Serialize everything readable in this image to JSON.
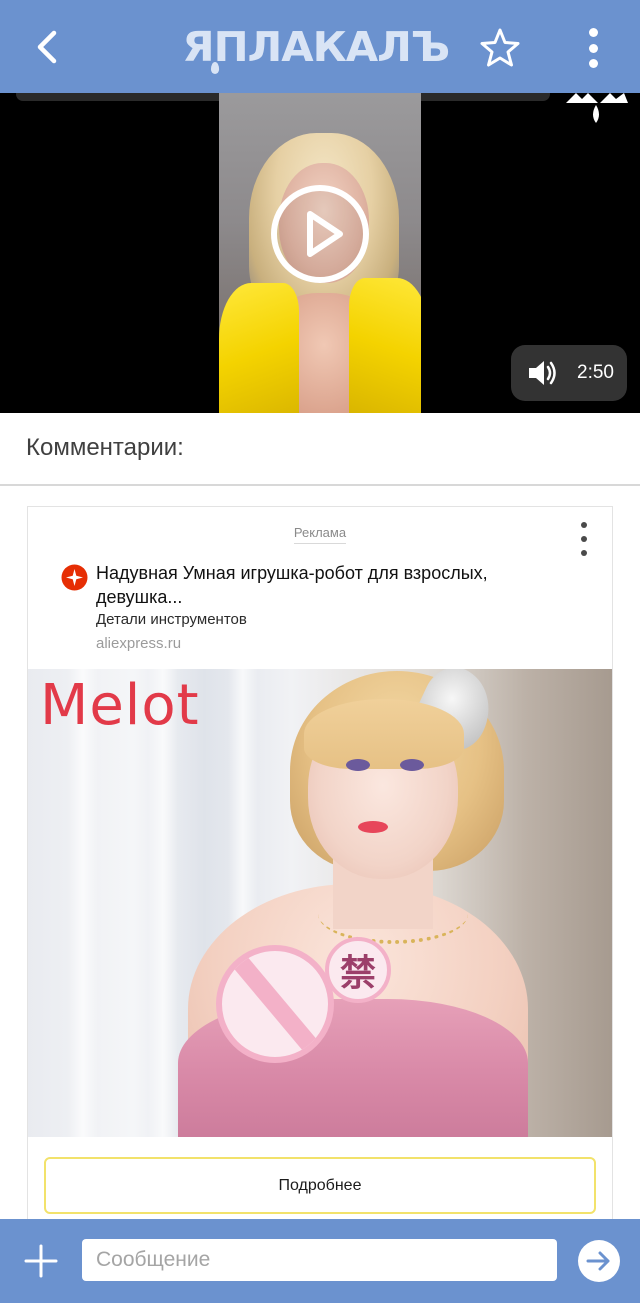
{
  "header": {
    "logo_text": "ЯПЛАКАЛЪ",
    "back_icon": "chevron-left-icon",
    "favorite_icon": "star-outline-icon",
    "menu_icon": "more-vertical-icon",
    "background_color": "#6b92cf"
  },
  "video": {
    "duration": "2:50",
    "play_icon": "play-circle-icon",
    "volume_icon": "volume-icon",
    "watermark_icon": "yaplakal-watermark-icon",
    "accent_color": "#f4d300"
  },
  "comments": {
    "title": "Комментарии:"
  },
  "ad": {
    "label": "Реклама",
    "headline": "Надувная Умная игрушка-робот для взрослых, девушка...",
    "subline": "Детали инструментов",
    "domain": "aliexpress.ru",
    "brand_text": "Melot",
    "censor_char": "禁",
    "cta_label": "Подробнее",
    "favicon_color": "#e62e04",
    "cta_border_color": "#f2e26b"
  },
  "composer": {
    "placeholder": "Сообщение",
    "plus_icon": "plus-icon",
    "send_icon": "arrow-right-icon",
    "background_color": "#6b92cf"
  }
}
